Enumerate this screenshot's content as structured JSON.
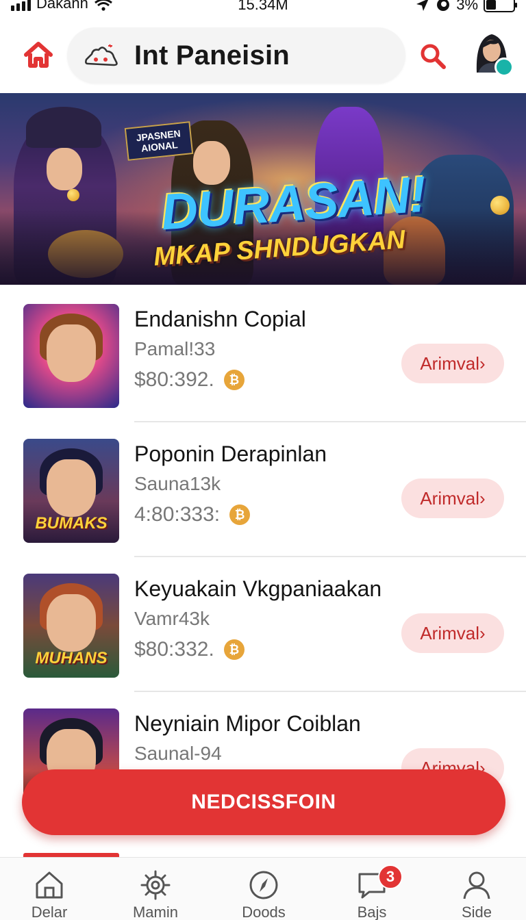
{
  "status_bar": {
    "carrier": "Dakann",
    "time": "15.34M",
    "battery": "3%"
  },
  "header": {
    "title": "Int Paneisin",
    "home_icon": "home-icon",
    "cloud_icon": "cloud-icon",
    "search_icon": "search-icon",
    "accent": "#e23434"
  },
  "banner": {
    "tag": "JPASNEN AIONAL",
    "headline": "DURASAN!",
    "subheadline": "MKAP SHNDUGKAN"
  },
  "items": [
    {
      "name": "Endanishn Copial",
      "sub": "Pamal!33",
      "price": "$80:392.",
      "button": "Arimval›",
      "thumb_label": ""
    },
    {
      "name": "Poponin Derapinlan",
      "sub": "Sauna13k",
      "price": "4:80:333:",
      "button": "Arimval›",
      "thumb_label": "BUMAKS"
    },
    {
      "name": "Keyuakain Vkgpaniaakan",
      "sub": "Vamr43k",
      "price": "$80:332.",
      "button": "Arimval›",
      "thumb_label": "MUHANS"
    },
    {
      "name": "Neyniain Mipor Coiblan",
      "sub": "Saunal-94",
      "price": "",
      "button": "Arimval›",
      "thumb_label": ""
    }
  ],
  "cta": {
    "label": "NEDCISSFOIN"
  },
  "bottom_nav": [
    {
      "label": "Delar",
      "icon": "home-outline-icon"
    },
    {
      "label": "Mamin",
      "icon": "gear-icon"
    },
    {
      "label": "Doods",
      "icon": "compass-icon"
    },
    {
      "label": "Bajs",
      "icon": "chat-icon",
      "badge": "3"
    },
    {
      "label": "Side",
      "icon": "profile-icon"
    }
  ]
}
